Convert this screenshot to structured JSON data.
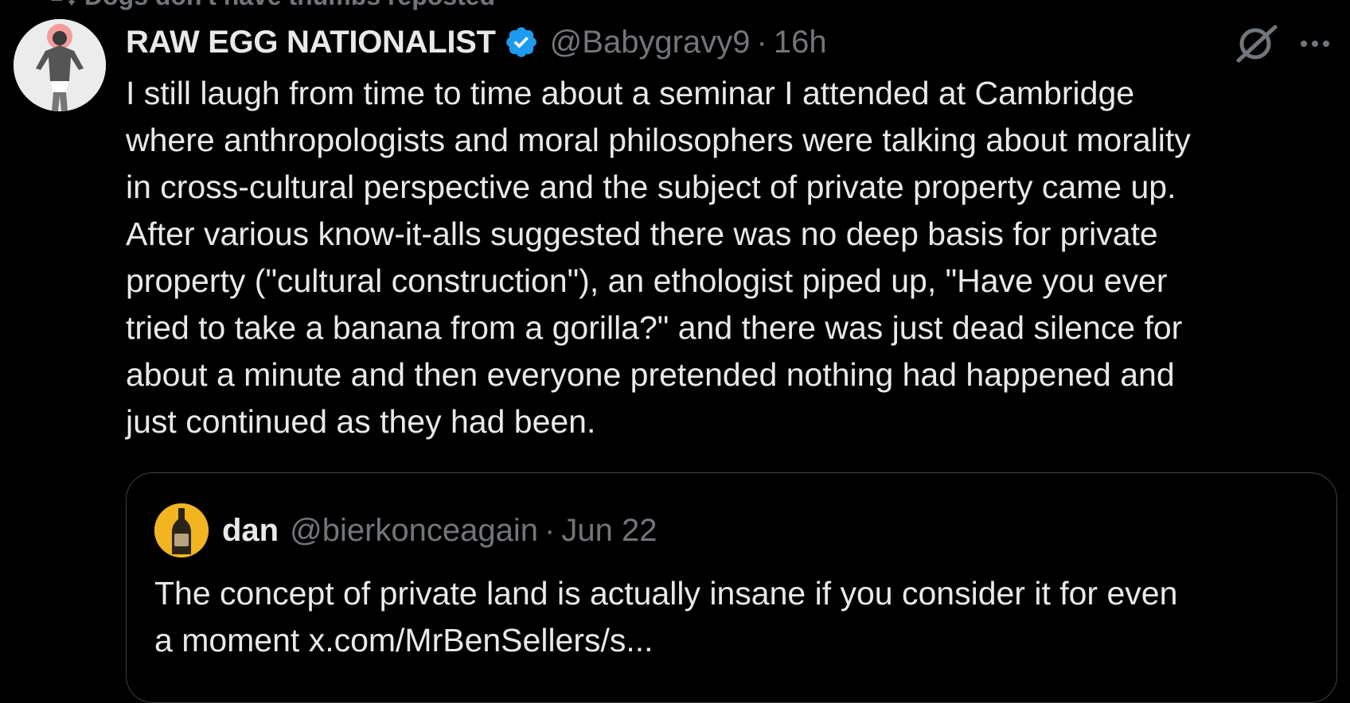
{
  "social_context": {
    "text": "Dogs don't have thumbs reposted"
  },
  "tweet": {
    "author_name": "RAW EGG NATIONALIST",
    "handle": "@Babygravy9",
    "separator": "·",
    "time": "16h",
    "lines": [
      "I still laugh from time to time about a seminar I attended at Cambridge",
      "where anthropologists and moral philosophers were talking about morality",
      "in cross-cultural perspective and the subject of private property came up.",
      "After various know-it-alls suggested there was no deep basis for private",
      "property (\"cultural construction\"), an ethologist piped up, \"Have you ever",
      "tried to take a banana from a gorilla?\" and there was just dead silence for",
      "about a minute and then everyone pretended nothing had happened and",
      "just continued as they had been."
    ]
  },
  "quoted_tweet": {
    "author_name": "dan",
    "handle": "@bierkonceagain",
    "separator": "·",
    "date": "Jun 22",
    "lines": [
      "The concept of private land is actually insane if you consider it for even",
      "a moment x.com/MrBenSellers/s..."
    ]
  },
  "icons": {
    "repost": "repost-icon",
    "verified": "verified-badge-icon",
    "grok": "grok-icon",
    "more": "more-options-icon"
  },
  "colors": {
    "background": "#000000",
    "text_primary": "#e7e9ea",
    "text_secondary": "#71767b",
    "verified_blue": "#1d9bf0",
    "quote_border": "#3d4247"
  }
}
